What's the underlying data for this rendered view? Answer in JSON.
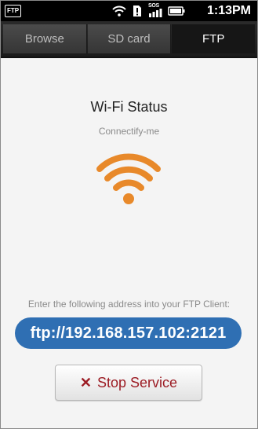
{
  "status_bar": {
    "notification_badge": "FTP",
    "sos_label": "SOS",
    "time": "1:13PM",
    "icons": [
      "wifi-icon",
      "sim-alert-icon",
      "signal-icon",
      "battery-icon"
    ]
  },
  "tabs": [
    {
      "label": "Browse",
      "active": false
    },
    {
      "label": "SD card",
      "active": false
    },
    {
      "label": "FTP",
      "active": true
    }
  ],
  "wifi": {
    "title": "Wi-Fi Status",
    "ssid": "Connectify-me",
    "icon": "wifi-signal-icon"
  },
  "ftp": {
    "hint": "Enter the following address into your FTP Client:",
    "address": "ftp://192.168.157.102:2121"
  },
  "stop_button": {
    "icon": "close-icon",
    "label": "Stop Service"
  },
  "colors": {
    "accent_orange": "#e8892a",
    "address_blue": "#2f6fb3",
    "stop_red": "#9c1c24"
  }
}
